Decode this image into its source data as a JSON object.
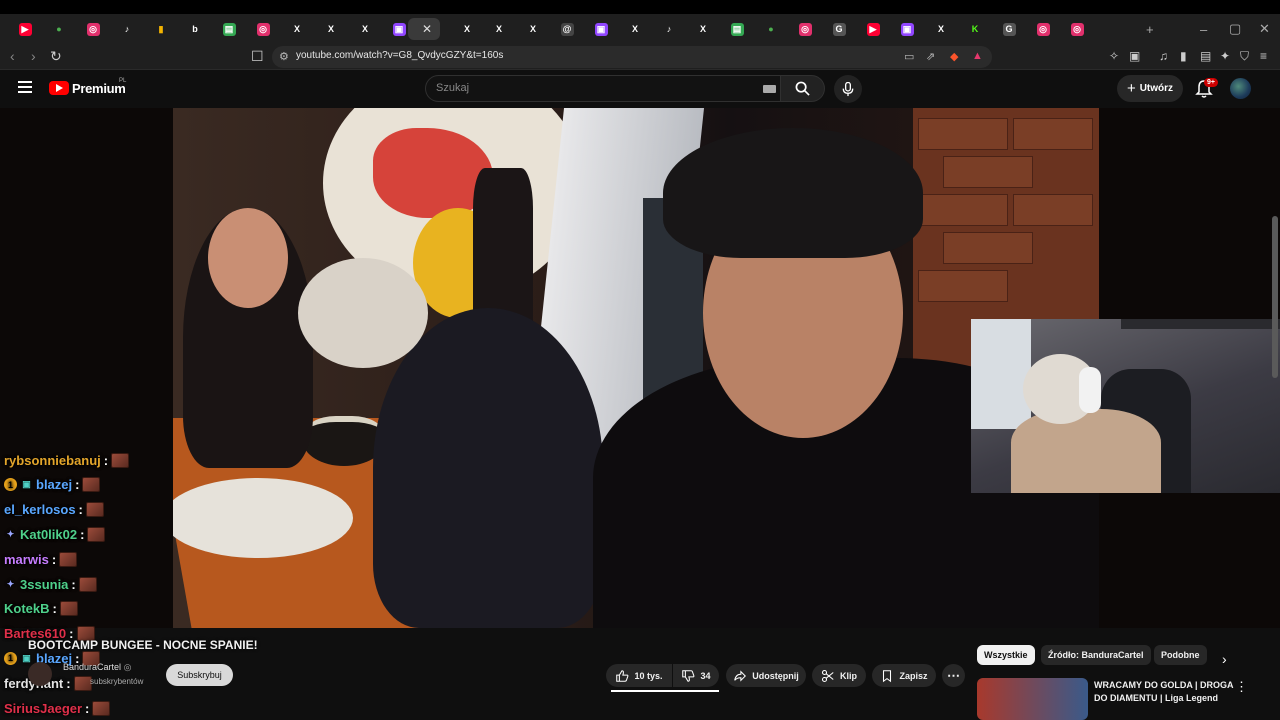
{
  "browser": {
    "tabs": [
      {
        "name": "youtube",
        "glyph": "▶",
        "color": "#ff0033",
        "bg": "#ff0033"
      },
      {
        "name": "maps",
        "glyph": "●",
        "color": "#4caf50",
        "bg": ""
      },
      {
        "name": "instagram",
        "glyph": "◎",
        "color": "#ffffff",
        "bg": "#e1306c"
      },
      {
        "name": "tiktok",
        "glyph": "♪",
        "color": "#ffffff",
        "bg": ""
      },
      {
        "name": "flag",
        "glyph": "▮",
        "color": "#f4b400",
        "bg": ""
      },
      {
        "name": "b",
        "glyph": "b",
        "color": "#ffffff",
        "bg": ""
      },
      {
        "name": "sheets",
        "glyph": "▤",
        "color": "#ffffff",
        "bg": "#34a853"
      },
      {
        "name": "instagram",
        "glyph": "◎",
        "color": "#ffffff",
        "bg": "#e1306c"
      },
      {
        "name": "x",
        "glyph": "X",
        "color": "#ffffff",
        "bg": ""
      },
      {
        "name": "x",
        "glyph": "X",
        "color": "#ffffff",
        "bg": ""
      },
      {
        "name": "x",
        "glyph": "X",
        "color": "#ffffff",
        "bg": ""
      },
      {
        "name": "twitch",
        "glyph": "▣",
        "color": "#ffffff",
        "bg": "#9146ff"
      },
      {
        "name": "x",
        "glyph": "X",
        "color": "#ffffff",
        "bg": ""
      },
      {
        "name": "x",
        "glyph": "X",
        "color": "#ffffff",
        "bg": ""
      },
      {
        "name": "x",
        "glyph": "X",
        "color": "#ffffff",
        "bg": ""
      },
      {
        "name": "threads",
        "glyph": "@",
        "color": "#ffffff",
        "bg": "#444"
      },
      {
        "name": "twitch",
        "glyph": "▣",
        "color": "#ffffff",
        "bg": "#9146ff"
      },
      {
        "name": "x",
        "glyph": "X",
        "color": "#ffffff",
        "bg": ""
      },
      {
        "name": "tiktok",
        "glyph": "♪",
        "color": "#ffffff",
        "bg": ""
      },
      {
        "name": "x",
        "glyph": "X",
        "color": "#ffffff",
        "bg": ""
      },
      {
        "name": "sheets",
        "glyph": "▤",
        "color": "#ffffff",
        "bg": "#34a853"
      },
      {
        "name": "maps",
        "glyph": "●",
        "color": "#4caf50",
        "bg": ""
      },
      {
        "name": "instagram",
        "glyph": "◎",
        "color": "#ffffff",
        "bg": "#e1306c"
      },
      {
        "name": "google",
        "glyph": "G",
        "color": "#ffffff",
        "bg": "#555"
      },
      {
        "name": "youtube",
        "glyph": "▶",
        "color": "#ff0033",
        "bg": "#ff0033"
      },
      {
        "name": "twitch",
        "glyph": "▣",
        "color": "#ffffff",
        "bg": "#9146ff"
      },
      {
        "name": "x",
        "glyph": "X",
        "color": "#ffffff",
        "bg": ""
      },
      {
        "name": "kick",
        "glyph": "K",
        "color": "#53fc18",
        "bg": ""
      },
      {
        "name": "google",
        "glyph": "G",
        "color": "#ffffff",
        "bg": "#555"
      },
      {
        "name": "instagram",
        "glyph": "◎",
        "color": "#ffffff",
        "bg": "#e1306c"
      },
      {
        "name": "instagram",
        "glyph": "◎",
        "color": "#ffffff",
        "bg": "#e1306c"
      }
    ],
    "url": "youtube.com/watch?v=G8_QvdycGZY&t=160s",
    "extensions": [
      "puzzle-icon",
      "reader-icon",
      "music-icon",
      "sidebar-icon",
      "wallet-icon",
      "leo-icon",
      "shield-icon",
      "menu-icon"
    ]
  },
  "masthead": {
    "brand": "Premium",
    "country": "PL",
    "search_placeholder": "Szukaj",
    "create_label": "Utwórz",
    "notifications_badge": "9+"
  },
  "chat": [
    {
      "user": "rybsonniebanuj",
      "color": "#e3a52b",
      "badges": []
    },
    {
      "user": "blazej",
      "color": "#5aa7ff",
      "badges": [
        "1",
        "sub"
      ]
    },
    {
      "user": "el_kerlosos",
      "color": "#5aa7ff",
      "badges": []
    },
    {
      "user": "Kat0lik02",
      "color": "#4fd18b",
      "badges": [
        "star"
      ]
    },
    {
      "user": "marwis",
      "color": "#c77dff",
      "badges": []
    },
    {
      "user": "3ssunia",
      "color": "#4fd18b",
      "badges": [
        "star"
      ]
    },
    {
      "user": "KotekB",
      "color": "#4fd18b",
      "badges": []
    },
    {
      "user": "Bartes610",
      "color": "#e0304a",
      "badges": []
    },
    {
      "user": "blazej",
      "color": "#5aa7ff",
      "badges": [
        "1",
        "sub"
      ]
    },
    {
      "user": "ferdynant",
      "color": "#e3e3e3",
      "badges": []
    },
    {
      "user": "SiriusJaeger",
      "color": "#e0304a",
      "badges": []
    }
  ],
  "video": {
    "title": "BOOTCAMP BUNGEE - NOCNE SPANIE!",
    "channel": "BanduraCartel",
    "subscribers": "subskrybentów",
    "subscribe_label": "Subskrybuj",
    "likes": "10 tys.",
    "dislikes": "34",
    "share_label": "Udostępnij",
    "clip_label": "Klip",
    "save_label": "Zapisz"
  },
  "sidebar": {
    "chips": [
      "Wszystkie",
      "Źródło: BanduraCartel",
      "Podobne"
    ],
    "recommendation_title": "WRACAMY DO GOLDA | DROGA DO DIAMENTU | Liga Legend"
  }
}
